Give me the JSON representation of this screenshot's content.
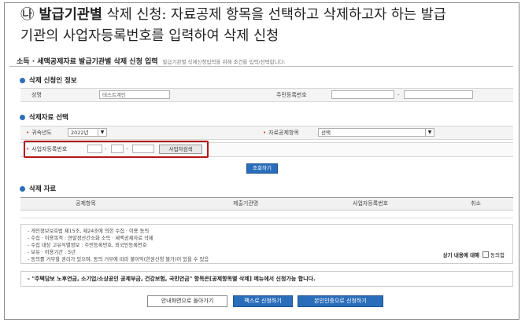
{
  "heading": {
    "marker": "㉯",
    "bold": "발급기관별",
    "line1": " 삭제 신청: 자료공제 항목을 선택하고 삭제하고자 하는 발급",
    "line2": "기관의 사업자등록번호를 입력하여 삭제 신청"
  },
  "page": {
    "title": "소득 · 세액공제자료 발급기관별 삭제 신청 입력",
    "subtitle": "발급기관별 삭제신청입력을 위해 조건을 입력/선택합니다."
  },
  "applicant": {
    "section_title": "삭제 신청인 정보",
    "name_label": "성명",
    "name_value": "테스트계인",
    "rrn_label": "주민등록번호",
    "rrn_sep": "-"
  },
  "selection": {
    "section_title": "삭제자료 선택",
    "year_label": "귀속년도",
    "year_value": "2022년",
    "item_label": "자료공제항목",
    "item_value": "선택",
    "bizno_label": "사업자등록번호",
    "sep": "-",
    "search_button": "사업자검색",
    "query_button": "조회하기"
  },
  "data_table": {
    "section_title": "삭제 자료",
    "columns": [
      "공제항목",
      "제출기관명",
      "사업자등록번호",
      "취소"
    ]
  },
  "notice": {
    "lines": [
      "- 개인정보보호법 제15조, 제24조에 의한 수집 · 이용 동의",
      "- 수집 · 이용목적 : 연말정산간소화 소득 · 세액공제자료 삭제",
      "- 수집 대상 고유식별정보 : 주민등록번호, 외국인등록번호",
      "- 보유 · 이용기간 : 5년",
      "- 동의를 거부할 권리가 있으며, 동의 거부에 따라 불이익(한원신청 불가)이 있을 수 있음"
    ],
    "agree_prefix": "상기 내용에 대해",
    "agree_label": "동의함"
  },
  "bottom_notice": "- \"주택담보 노후연금, 소기업/소상공인 공제부금, 건강보험, 국민연금\" 항목은[공제항목별 삭제] 메뉴에서 신청가능 합니다.",
  "buttons": {
    "back": "안내화면으로 돌아가기",
    "fax": "팩스로 신청하기",
    "auth": "본인인증으로 신청하기"
  },
  "colors": {
    "accent": "#2a6ebb",
    "highlight": "#b51515",
    "required": "#dd3333"
  }
}
